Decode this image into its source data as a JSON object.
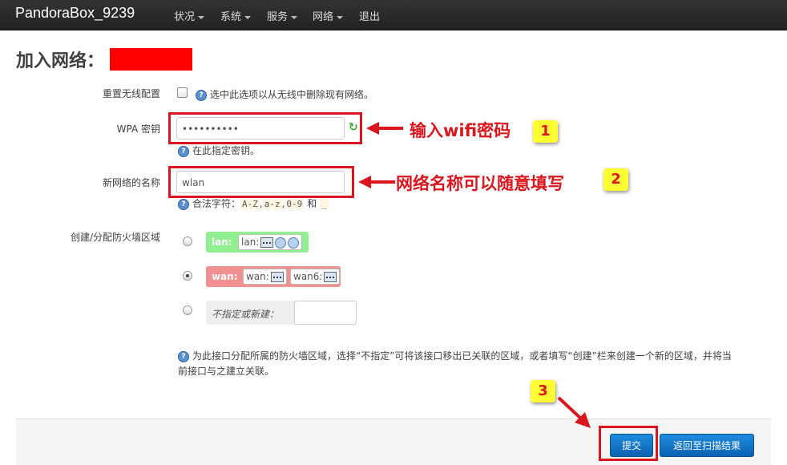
{
  "navbar": {
    "brand": "PandoraBox_9239",
    "menu": [
      {
        "label": "状况"
      },
      {
        "label": "系统"
      },
      {
        "label": "服务"
      },
      {
        "label": "网络"
      },
      {
        "label": "退出"
      }
    ]
  },
  "page": {
    "title": "加入网络："
  },
  "form": {
    "reset": {
      "label": "重置无线配置",
      "help": "选中此选项以从无线中删除现有网络。"
    },
    "wpa": {
      "label": "WPA 密钥",
      "value": "••••••••••",
      "help": "在此指定密钥。"
    },
    "netname": {
      "label": "新网络的名称",
      "value": "wlan",
      "help_prefix": "合法字符：",
      "code1": "A-Z",
      "sep1": ",",
      "code2": "a-z",
      "sep2": ",",
      "code3": "0-9",
      "and": "和",
      "code4": "_"
    },
    "zone": {
      "label": "创建/分配防火墙区域",
      "lan_name": "lan:",
      "lan_iface": "lan:",
      "wan_name": "wan:",
      "wan_iface": "wan:",
      "wan6_iface": "wan6:",
      "new_label": "不指定或新建：",
      "new_value": "",
      "help_line1": "为此接口分配所属的防火墙区域，选择“不指定”可将该接口移出已关联的区域，或者填写“创建”栏来创建一个新的区域，并将当",
      "help_line2": "前接口与之建立关联。"
    }
  },
  "annotations": {
    "wpa_note": "输入wifi密码",
    "name_note": "网络名称可以随意填写",
    "badge1": "1",
    "badge2": "2",
    "badge3": "3"
  },
  "buttons": {
    "submit": "提交",
    "back": "返回至扫描结果"
  },
  "colors": {
    "navbar": "#222222",
    "lan_zone": "#90f090",
    "wan_zone": "#f09090",
    "annotation_red": "#d9161d",
    "badge_yellow": "#ffff33",
    "button_blue": "#1a7fd0"
  }
}
